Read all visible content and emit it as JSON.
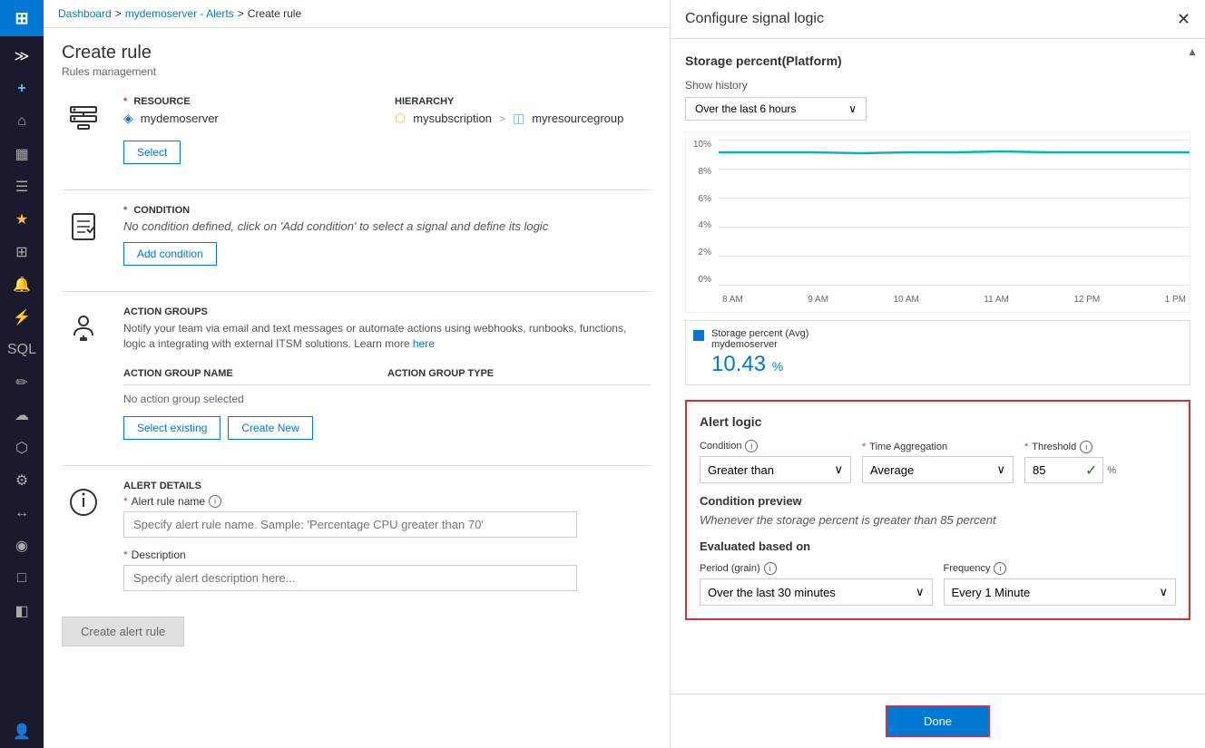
{
  "breadcrumb": {
    "items": [
      "Dashboard",
      "mydemoserver - Alerts",
      "Create rule"
    ],
    "separators": [
      ">",
      ">"
    ]
  },
  "page": {
    "title": "Create rule",
    "subtitle": "Rules management"
  },
  "resource_section": {
    "label": "RESOURCE",
    "required": "*",
    "hierarchy_label": "HIERARCHY",
    "server": "mydemoserver",
    "subscription": "mysubscription",
    "resource_group": "myresourcegroup",
    "select_button": "Select"
  },
  "condition_section": {
    "label": "CONDITION",
    "required": "*",
    "no_condition_text": "No condition defined, click on 'Add condition' to select a signal and define its logic",
    "add_condition_button": "Add condition"
  },
  "action_groups_section": {
    "label": "ACTION GROUPS",
    "description": "Notify your team via email and text messages or automate actions using webhooks, runbooks, functions, logic a integrating with external ITSM solutions. Learn more",
    "learn_more_link": "here",
    "col_name": "ACTION GROUP NAME",
    "col_type": "ACTION GROUP TYPE",
    "no_action_text": "No action group selected",
    "select_existing_button": "Select existing",
    "create_new_button": "Create New"
  },
  "alert_details_section": {
    "label": "ALERT DETAILS",
    "rule_name_label": "Alert rule name",
    "rule_name_info": true,
    "rule_name_placeholder": "Specify alert rule name. Sample: 'Percentage CPU greater than 70'",
    "description_label": "Description",
    "description_placeholder": "Specify alert description here..."
  },
  "create_rule_button": "Create alert rule",
  "right_panel": {
    "title": "Configure signal logic",
    "signal_title": "Storage percent(Platform)",
    "show_history_label": "Show history",
    "show_history_value": "Over the last 6 hours",
    "chart": {
      "y_labels": [
        "10%",
        "8%",
        "6%",
        "4%",
        "2%",
        "0%"
      ],
      "x_labels": [
        "8 AM",
        "9 AM",
        "10 AM",
        "11 AM",
        "12 PM",
        "1 PM"
      ],
      "line_color": "#00b7c3",
      "threshold_value": 10.43,
      "legend_label": "Storage percent (Avg)",
      "legend_sublabel": "mydemoserver",
      "legend_value": "10.43",
      "legend_unit": "%"
    },
    "alert_logic": {
      "title": "Alert logic",
      "condition_label": "Condition",
      "condition_info": true,
      "time_agg_label": "Time Aggregation",
      "time_agg_required": "*",
      "threshold_label": "Threshold",
      "threshold_required": "*",
      "threshold_info": true,
      "condition_value": "Greater than",
      "time_agg_value": "Average",
      "threshold_value": "85",
      "threshold_unit": "%",
      "condition_preview_label": "Condition preview",
      "condition_preview_text": "Whenever the storage percent is greater than 85 percent",
      "evaluated_label": "Evaluated based on",
      "period_label": "Period (grain)",
      "period_info": true,
      "period_value": "Over the last 30 minutes",
      "frequency_label": "Frequency",
      "frequency_info": true,
      "frequency_value": "Every 1 Minute"
    },
    "done_button": "Done"
  },
  "sidebar": {
    "icons": [
      {
        "name": "expand-icon",
        "symbol": "≫"
      },
      {
        "name": "plus-icon",
        "symbol": "+"
      },
      {
        "name": "home-icon",
        "symbol": "⌂"
      },
      {
        "name": "dashboard-icon",
        "symbol": "▦"
      },
      {
        "name": "menu-icon",
        "symbol": "☰"
      },
      {
        "name": "favorites-icon",
        "symbol": "★"
      },
      {
        "name": "apps-icon",
        "symbol": "⊞"
      },
      {
        "name": "notifications-icon",
        "symbol": "🔔"
      },
      {
        "name": "lightning-icon",
        "symbol": "⚡"
      },
      {
        "name": "sql-icon",
        "symbol": "SQL"
      },
      {
        "name": "edit-icon",
        "symbol": "✏"
      },
      {
        "name": "cloud-icon",
        "symbol": "☁"
      },
      {
        "name": "shield-icon",
        "symbol": "🛡"
      },
      {
        "name": "settings2-icon",
        "symbol": "⚙"
      },
      {
        "name": "arrows-icon",
        "symbol": "↔"
      },
      {
        "name": "circle-icon",
        "symbol": "◉"
      },
      {
        "name": "monitor-icon",
        "symbol": "🖥"
      },
      {
        "name": "puzzle-icon",
        "symbol": "🧩"
      },
      {
        "name": "user-icon",
        "symbol": "👤"
      }
    ]
  }
}
